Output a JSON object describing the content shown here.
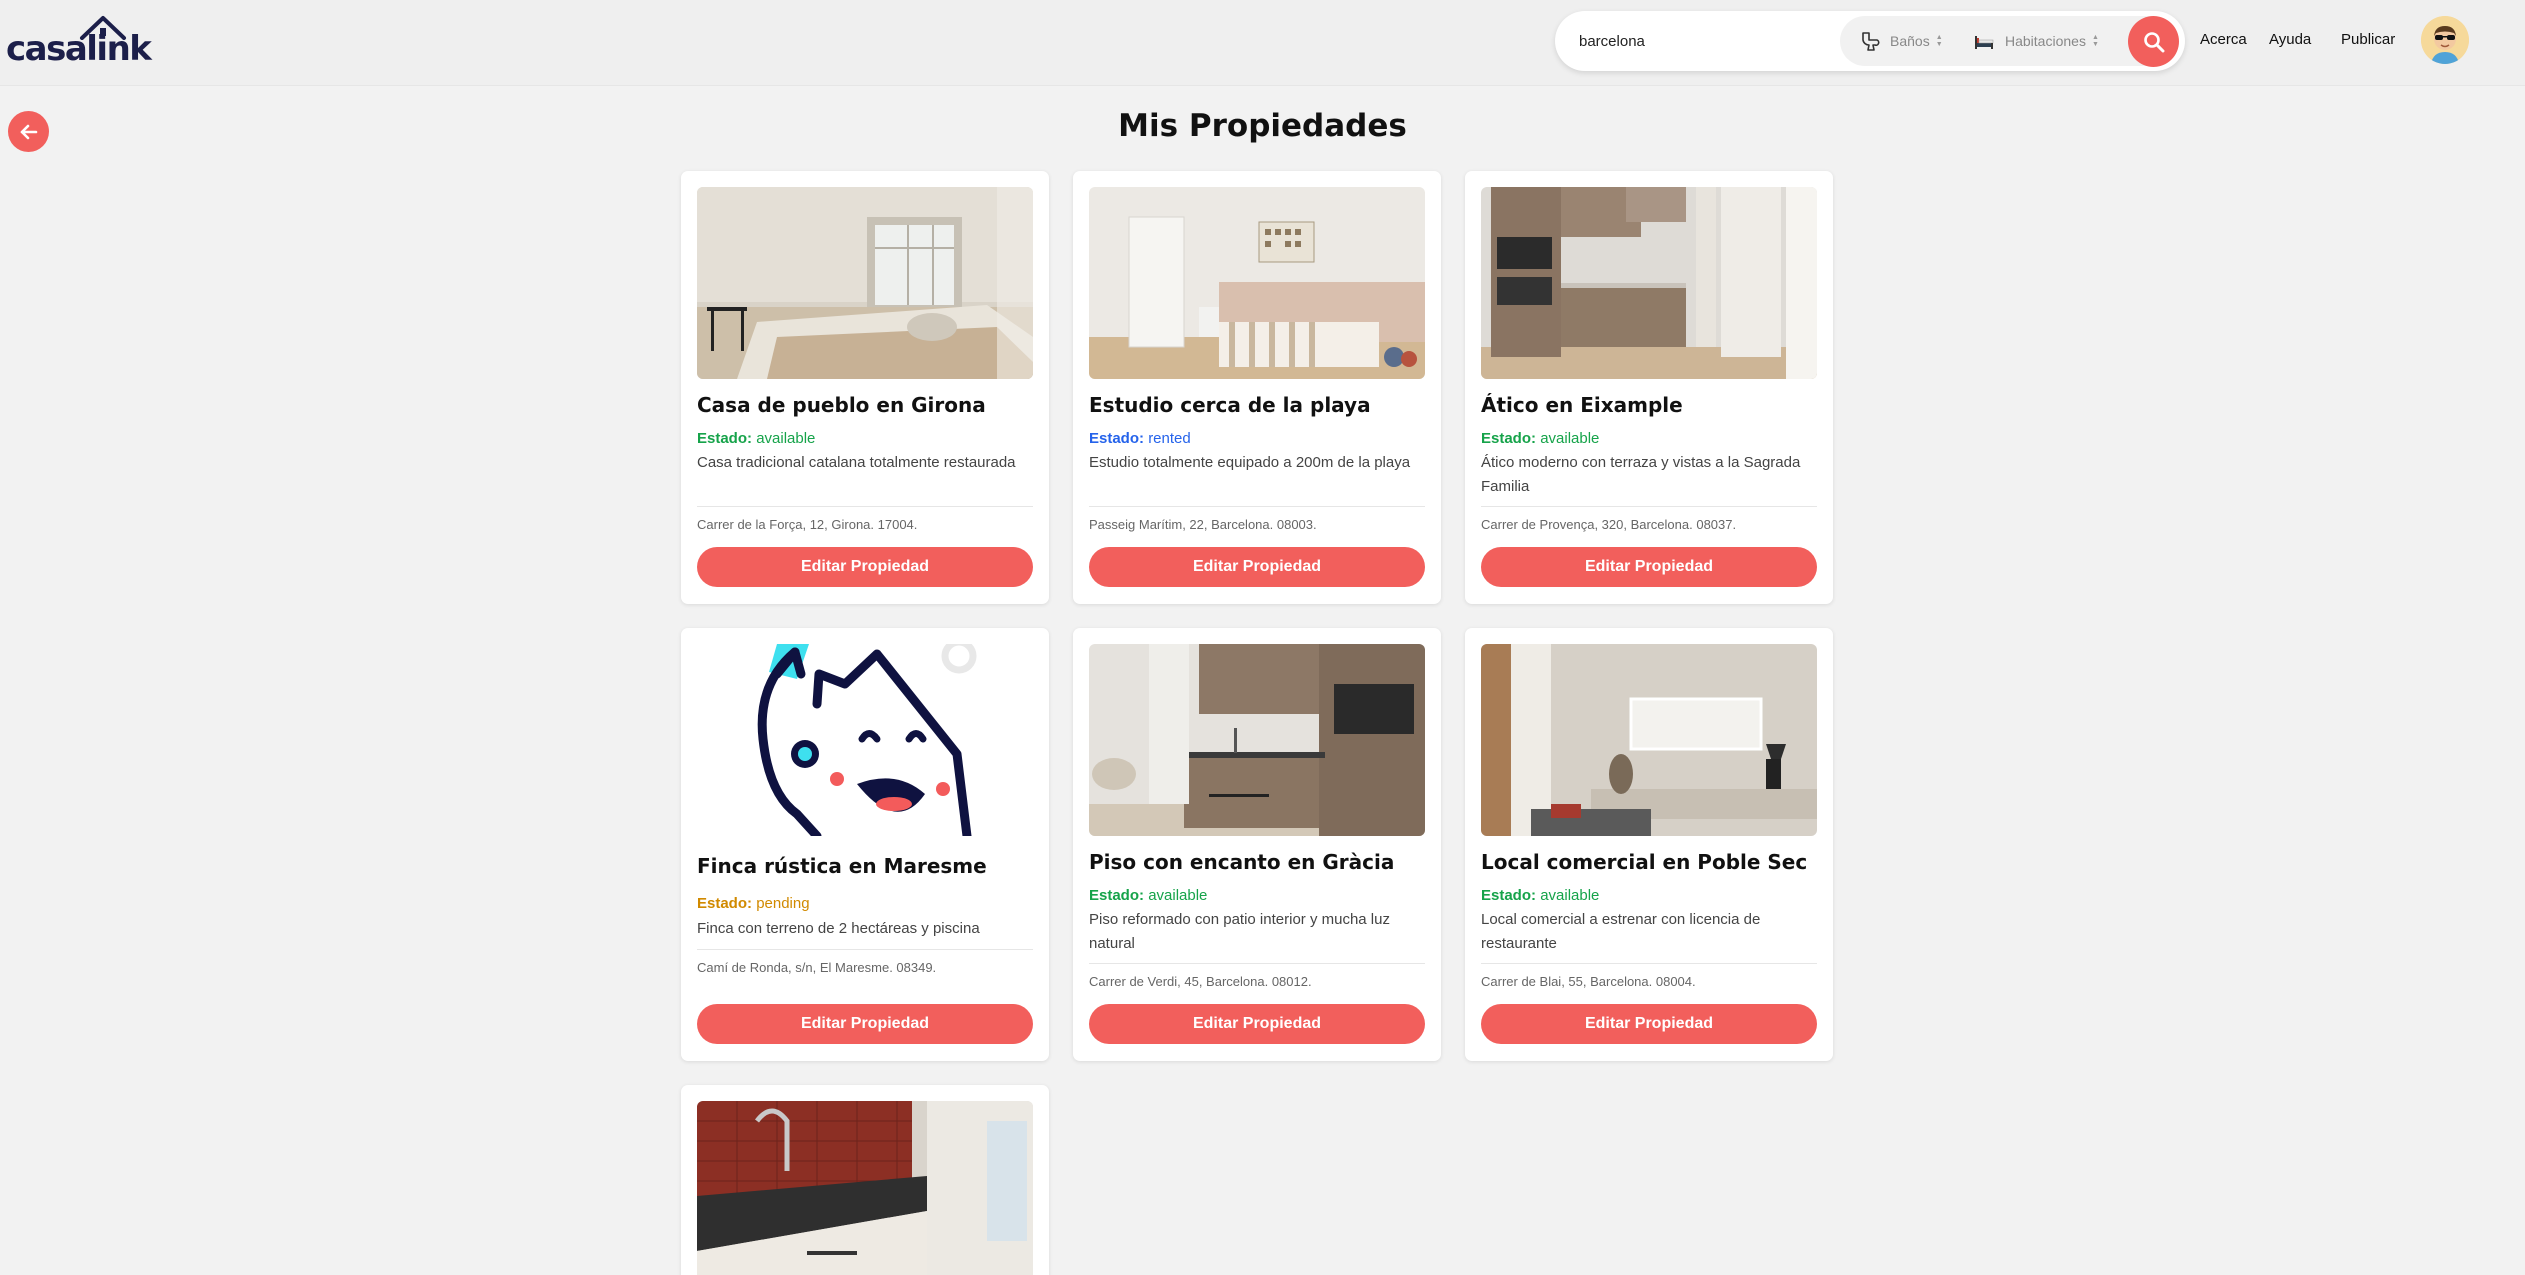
{
  "header": {
    "logo_text": "casalink",
    "search": {
      "value": "barcelona"
    },
    "filters": {
      "banos_placeholder": "Baños",
      "habitaciones_placeholder": "Habitaciones"
    },
    "nav": {
      "acerca": "Acerca",
      "ayuda": "Ayuda",
      "publicar": "Publicar"
    }
  },
  "page": {
    "title": "Mis Propiedades"
  },
  "colors": {
    "accent": "#f25f5c",
    "available": "#16a34a",
    "rented": "#2563eb",
    "pending": "#d18a00"
  },
  "properties": [
    {
      "title": "Casa de pueblo en Girona",
      "status_label": "Estado:",
      "status": "available",
      "description": "Casa tradicional catalana totalmente restaurada",
      "address": "Carrer de la Força, 12, Girona. 17004.",
      "button": "Editar Propiedad"
    },
    {
      "title": "Estudio cerca de la playa",
      "status_label": "Estado:",
      "status": "rented",
      "description": "Estudio totalmente equipado a 200m de la playa",
      "address": "Passeig Marítim, 22, Barcelona. 08003.",
      "button": "Editar Propiedad"
    },
    {
      "title": "Ático en Eixample",
      "status_label": "Estado:",
      "status": "available",
      "description": "Ático moderno con terraza y vistas a la Sagrada Familia",
      "address": "Carrer de Provença, 320, Barcelona. 08037.",
      "button": "Editar Propiedad"
    },
    {
      "title": "Finca rústica en Maresme",
      "status_label": "Estado:",
      "status": "pending",
      "description": "Finca con terreno de 2 hectáreas y piscina",
      "address": "Camí de Ronda, s/n, El Maresme. 08349.",
      "button": "Editar Propiedad"
    },
    {
      "title": "Piso con encanto en Gràcia",
      "status_label": "Estado:",
      "status": "available",
      "description": "Piso reformado con patio interior y mucha luz natural",
      "address": "Carrer de Verdi, 45, Barcelona. 08012.",
      "button": "Editar Propiedad"
    },
    {
      "title": "Local comercial en Poble Sec",
      "status_label": "Estado:",
      "status": "available",
      "description": "Local comercial a estrenar con licencia de restaurante",
      "address": "Carrer de Blai, 55, Barcelona. 08004.",
      "button": "Editar Propiedad"
    }
  ]
}
